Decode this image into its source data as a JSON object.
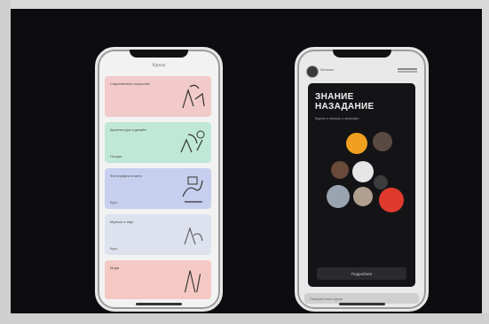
{
  "left_phone": {
    "app_title": "Курсы",
    "cards": [
      {
        "title": "Современное искусство",
        "subtitle": "",
        "color": "#f2caca"
      },
      {
        "title": "Архитектура и дизайн",
        "subtitle": "Лекции",
        "color": "#bfe8d6"
      },
      {
        "title": "Фотография и кино",
        "subtitle": "Курс",
        "color": "#c7cfee"
      },
      {
        "title": "Музыка и звук",
        "subtitle": "Курс",
        "color": "#dde2ee"
      },
      {
        "title": "Мода",
        "subtitle": "",
        "color": "#f4c9c4"
      }
    ]
  },
  "right_phone": {
    "header_name": "Магазин",
    "promo_title": "ЗНАНИЕ НАЗАДАНИЕ",
    "promo_subtitle": "Курсы и лекции о культуре",
    "promo_button": "Подробнее",
    "bottom_bar_text": "Смотреть все курсы",
    "circles": [
      {
        "color": "#f0a020"
      },
      {
        "color": "#e0e0e0"
      },
      {
        "color": "#e03a2e"
      },
      {
        "color": "#9aa4b0"
      },
      {
        "color": "#e8e8e8"
      }
    ]
  }
}
